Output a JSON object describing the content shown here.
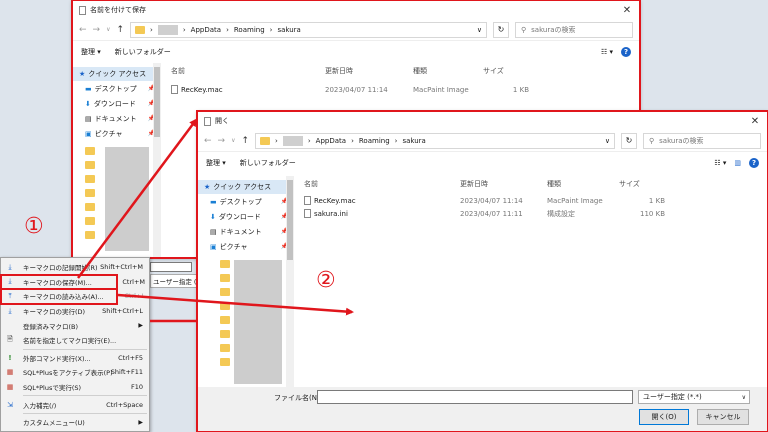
{
  "save_dialog": {
    "title": "名前を付けて保存",
    "path": [
      "AppData",
      "Roaming",
      "sakura"
    ],
    "search_placeholder": "sakuraの検索",
    "toolbar": {
      "organize": "整理 ▾",
      "new_folder": "新しいフォルダー"
    },
    "nav": {
      "quick_access": "クイック アクセス",
      "items": [
        "デスクトップ",
        "ダウンロード",
        "ドキュメント",
        "ピクチャ"
      ]
    },
    "columns": [
      "名前",
      "更新日時",
      "種類",
      "サイズ"
    ],
    "files": [
      {
        "name": "RecKey.mac",
        "date": "2023/04/07 11:14",
        "type": "MacPaint Image",
        "size": "1 KB"
      }
    ]
  },
  "open_dialog": {
    "title": "開く",
    "path": [
      "AppData",
      "Roaming",
      "sakura"
    ],
    "search_placeholder": "sakuraの検索",
    "toolbar": {
      "organize": "整理 ▾",
      "new_folder": "新しいフォルダー"
    },
    "nav": {
      "quick_access": "クイック アクセス",
      "items": [
        "デスクトップ",
        "ダウンロード",
        "ドキュメント",
        "ピクチャ"
      ]
    },
    "columns": [
      "名前",
      "更新日時",
      "種類",
      "サイズ"
    ],
    "files": [
      {
        "name": "RecKey.mac",
        "date": "2023/04/07 11:14",
        "type": "MacPaint Image",
        "size": "1 KB"
      },
      {
        "name": "sakura.ini",
        "date": "2023/04/07 11:11",
        "type": "構成設定",
        "size": "110 KB"
      }
    ],
    "filename_label": "ファイル名(N):",
    "file_type": "ユーザー指定 (*.*)",
    "open_button": "開く(O)",
    "cancel_button": "キャンセル"
  },
  "context_menu": {
    "items": [
      {
        "label": "キーマクロの記録開始(R)",
        "shortcut": "Shift+Ctrl+M"
      },
      {
        "label": "キーマクロの保存(M)...",
        "shortcut": "Ctrl+M"
      },
      {
        "label": "キーマクロの読み込み(A)...",
        "shortcut": "Ctrl+L"
      },
      {
        "label": "キーマクロの実行(D)",
        "shortcut": "Shift+Ctrl+L"
      },
      {
        "label": "登録済みマクロ(B)",
        "shortcut": ""
      },
      {
        "label": "名前を指定してマクロ実行(E)...",
        "shortcut": ""
      },
      {
        "label": "外部コマンド実行(X)...",
        "shortcut": "Ctrl+F5"
      },
      {
        "label": "SQL*Plusをアクティブ表示(P)",
        "shortcut": "Shift+F11"
      },
      {
        "label": "SQL*Plusで実行(S)",
        "shortcut": "F10"
      },
      {
        "label": "入力補完(/)",
        "shortcut": "Ctrl+Space"
      },
      {
        "label": "カスタムメニュー(U)",
        "shortcut": ""
      }
    ]
  },
  "behind_save": {
    "file_type": "ユーザー指定 (*.*)"
  },
  "annotations": {
    "marker1": "①",
    "marker2": "②"
  },
  "colors": {
    "highlight": "#e0161c",
    "selection": "#d9e8f6",
    "accent": "#0078d7"
  }
}
